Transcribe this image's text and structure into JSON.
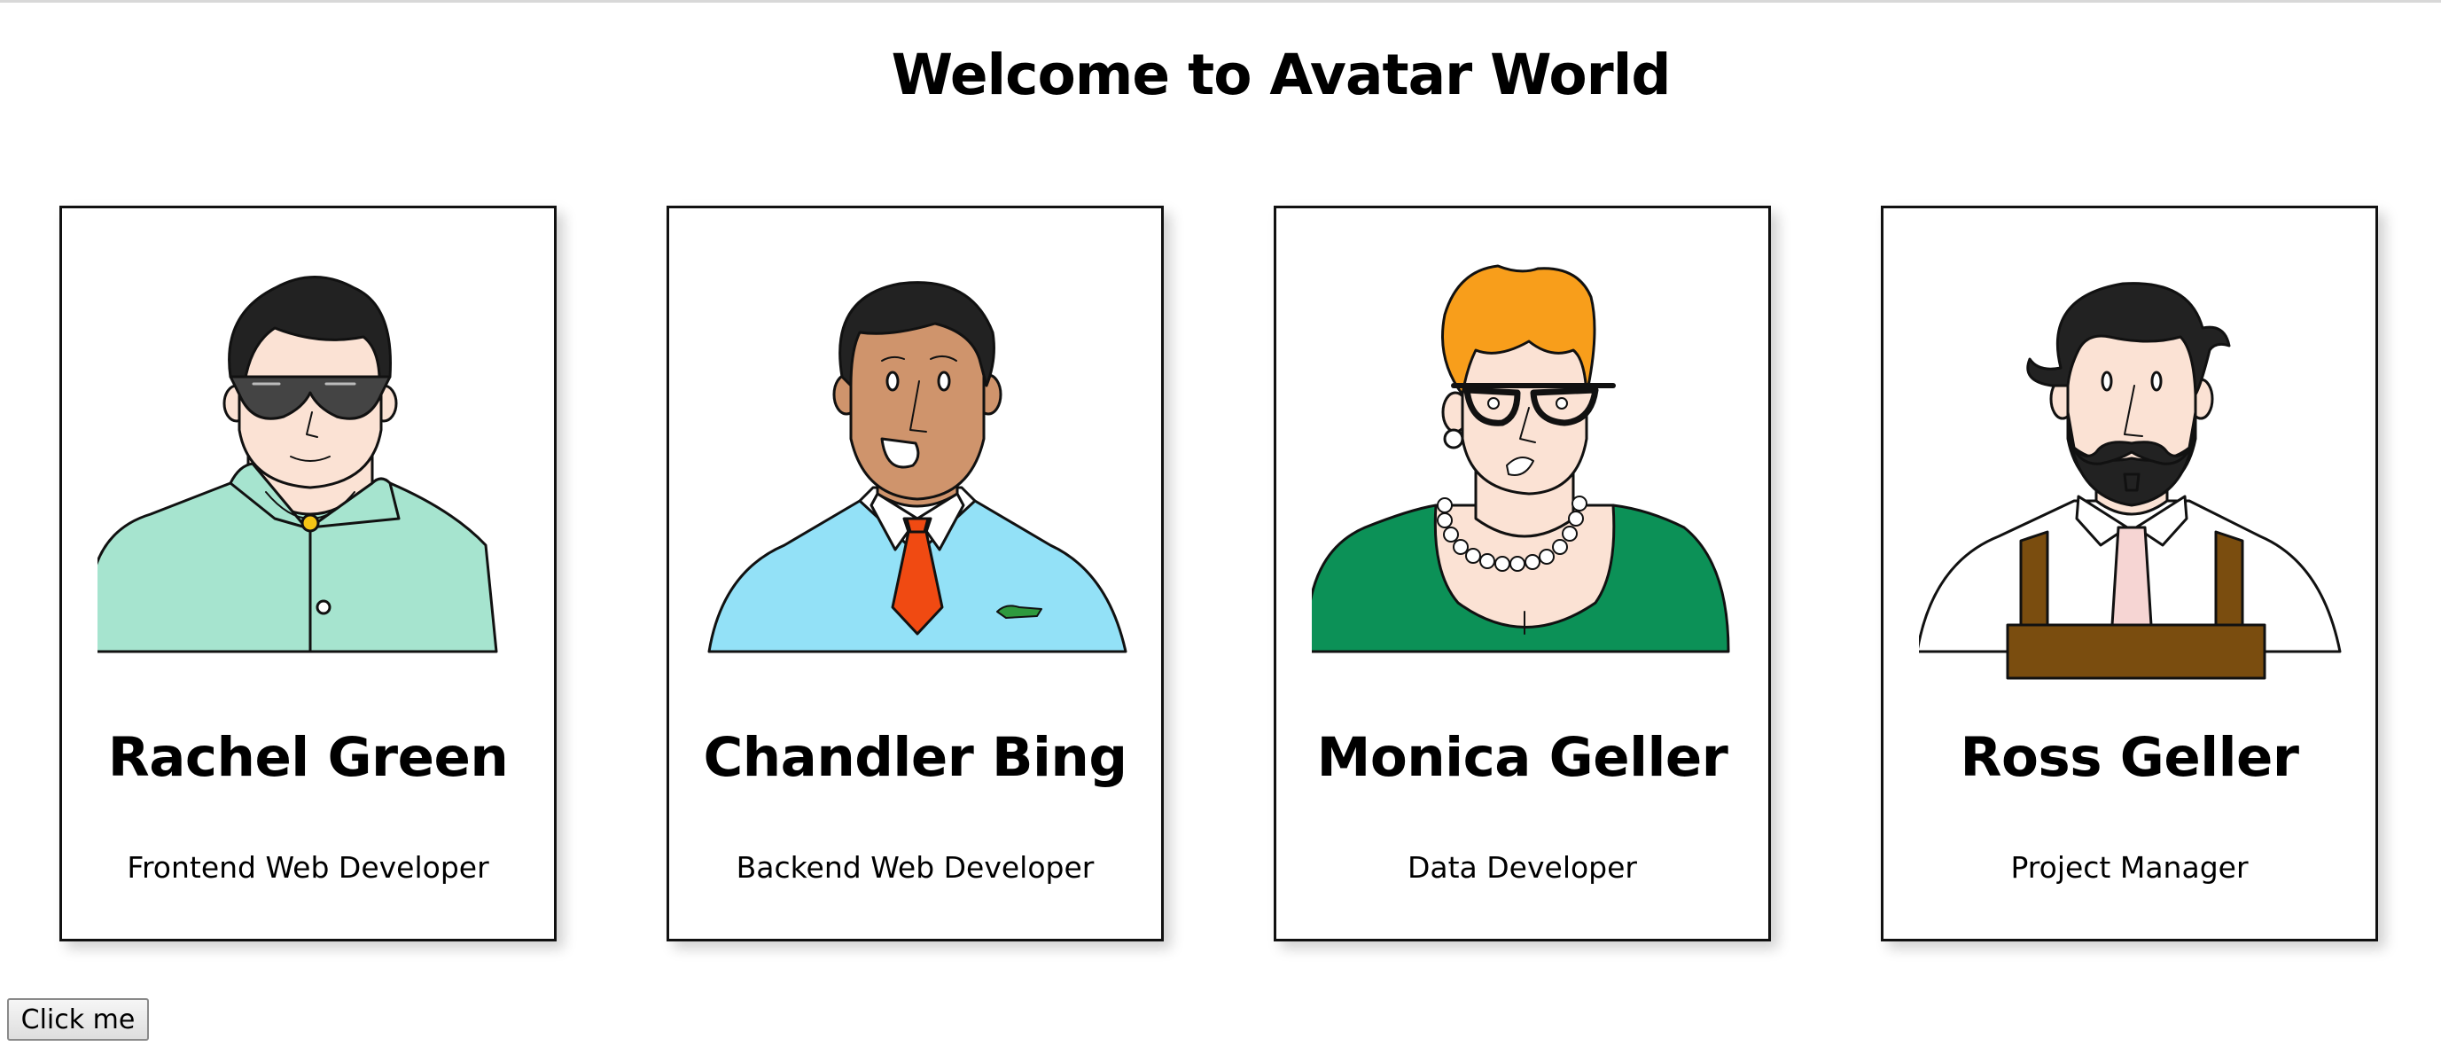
{
  "page": {
    "title": "Welcome to Avatar World"
  },
  "cards": [
    {
      "name": "Rachel Green",
      "role": "Frontend Web Developer"
    },
    {
      "name": "Chandler Bing",
      "role": "Backend Web Developer"
    },
    {
      "name": "Monica Geller",
      "role": "Data Developer"
    },
    {
      "name": "Ross Geller",
      "role": "Project Manager"
    }
  ],
  "button": {
    "label": "Click me"
  },
  "colors": {
    "rachel_shirt": "#a6e4cf",
    "chandler_sweater": "#93e1f7",
    "chandler_tie": "#f04a12",
    "monica_hair": "#f89e1b",
    "monica_dress": "#0c9157",
    "ross_apron": "#7a4d0f",
    "skin_light": "#fbe2d4",
    "skin_dark": "#cf946c",
    "hair_dark": "#222222"
  }
}
